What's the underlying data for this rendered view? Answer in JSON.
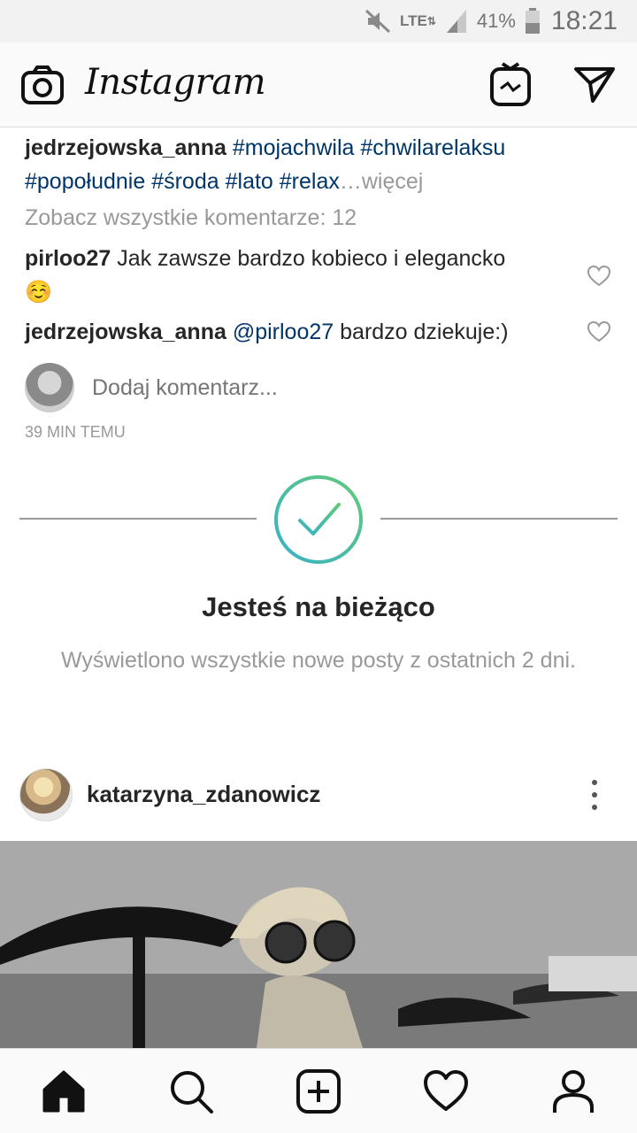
{
  "status_bar": {
    "network": "LTE",
    "battery": "41%",
    "time": "18:21"
  },
  "header": {
    "logo": "Instagram",
    "icons": [
      "camera-icon",
      "igtv-icon",
      "direct-message-icon"
    ]
  },
  "post_footer": {
    "caption_user": "jedrzejowska_anna",
    "hashtags": [
      "#mojachwila",
      "#chwilarelaksu",
      "#popołudnie",
      "#środa",
      "#lato",
      "#relax"
    ],
    "more_label": "…więcej",
    "view_all_comments": "Zobacz wszystkie komentarze: 12",
    "comments": [
      {
        "user": "pirloo27",
        "text": "Jak zawsze bardzo kobieco i elegancko",
        "emoji": "☺️"
      },
      {
        "user": "jedrzejowska_anna",
        "mention": "@pirloo27",
        "text": "bardzo dziekuje:)"
      }
    ],
    "add_comment_placeholder": "Dodaj komentarz...",
    "time_ago": "39 MIN TEMU"
  },
  "caught_up": {
    "title": "Jesteś na bieżąco",
    "subtitle": "Wyświetlono wszystkie nowe posty z ostatnich 2 dni.",
    "accent_start": "#3ab2c8",
    "accent_end": "#61c979"
  },
  "next_post": {
    "username": "katarzyna_zdanowicz"
  },
  "bottom_nav": [
    "home-icon",
    "search-icon",
    "add-post-icon",
    "activity-heart-icon",
    "profile-icon"
  ]
}
